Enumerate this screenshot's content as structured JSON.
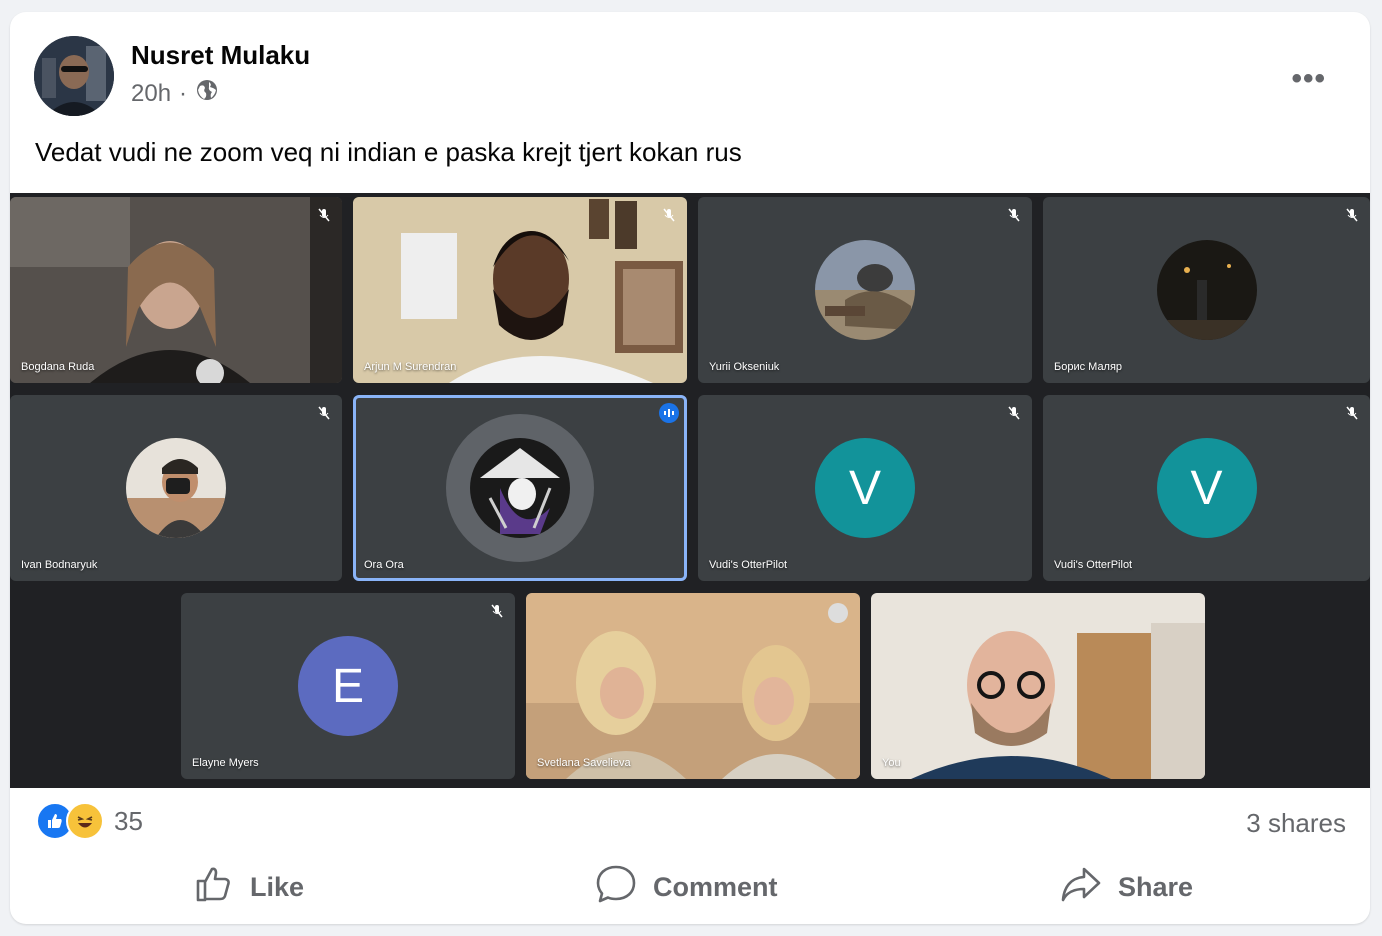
{
  "post": {
    "author": "Nusret Mulaku",
    "time": "20h",
    "separator": "·",
    "audience_icon": "globe-icon",
    "menu_icon": "more-options-icon",
    "menu_label": "•••",
    "text": "Vedat vudi ne zoom veq ni indian e paska krejt tjert kokan rus"
  },
  "meeting": {
    "participants": [
      {
        "name": "Bogdana Ruda",
        "kind": "video"
      },
      {
        "name": "Arjun M Surendran",
        "kind": "video"
      },
      {
        "name": "Yurii Okseniuk",
        "kind": "photo"
      },
      {
        "name": "Борис Маляр",
        "kind": "photo"
      },
      {
        "name": "Ivan Bodnaryuk",
        "kind": "photo"
      },
      {
        "name": "Ora Ora",
        "kind": "photo",
        "speaking": true
      },
      {
        "name": "Vudi's OtterPilot",
        "kind": "letter",
        "letter": "V",
        "color": "#12939a"
      },
      {
        "name": "Vudi's OtterPilot",
        "kind": "letter",
        "letter": "V",
        "color": "#12939a"
      },
      {
        "name": "Elayne Myers",
        "kind": "letter",
        "letter": "E",
        "color": "#5c6bc0"
      },
      {
        "name": "Svetlana Savelieva",
        "kind": "video"
      },
      {
        "name": "You",
        "kind": "video"
      }
    ]
  },
  "engagement": {
    "reaction_count": "35",
    "reactions": [
      "like-reaction-icon",
      "haha-reaction-icon"
    ],
    "shares": "3 shares"
  },
  "actions": {
    "like": "Like",
    "comment": "Comment",
    "share": "Share"
  },
  "colors": {
    "like_blue": "#1877f2",
    "meet_bg": "#202124",
    "tile_bg": "#3c4043",
    "speaking_border": "#8ab4f8"
  }
}
